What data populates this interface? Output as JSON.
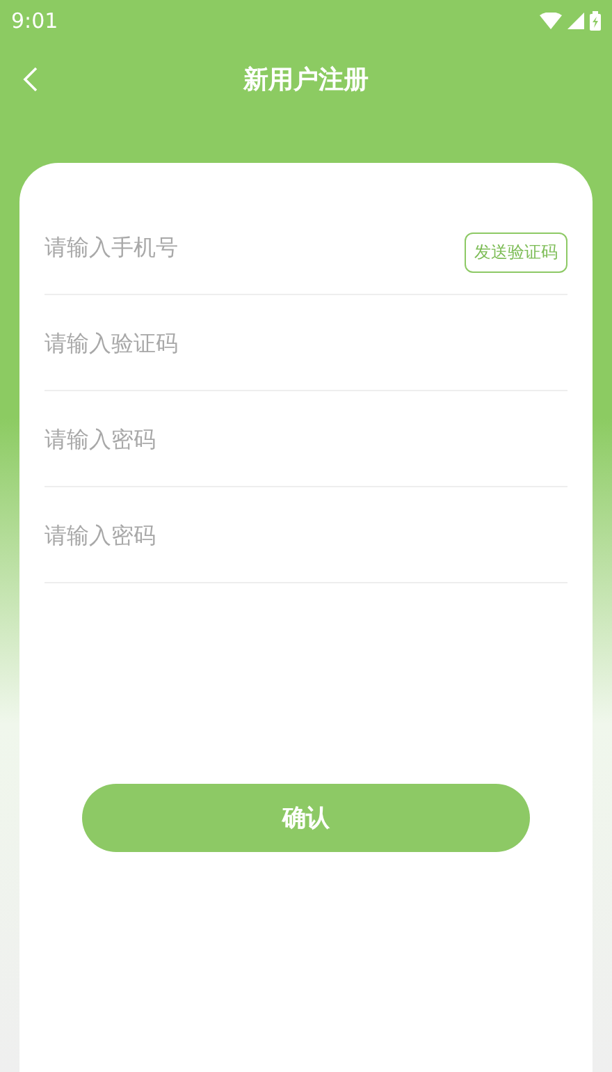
{
  "status_bar": {
    "time": "9:01"
  },
  "header": {
    "title": "新用户注册"
  },
  "fields": [
    {
      "placeholder": "请输入手机号",
      "action": "发送验证码"
    },
    {
      "placeholder": "请输入验证码"
    },
    {
      "placeholder": "请输入密码"
    },
    {
      "placeholder": "请输入密码"
    }
  ],
  "submit_button": {
    "label": "确认"
  }
}
